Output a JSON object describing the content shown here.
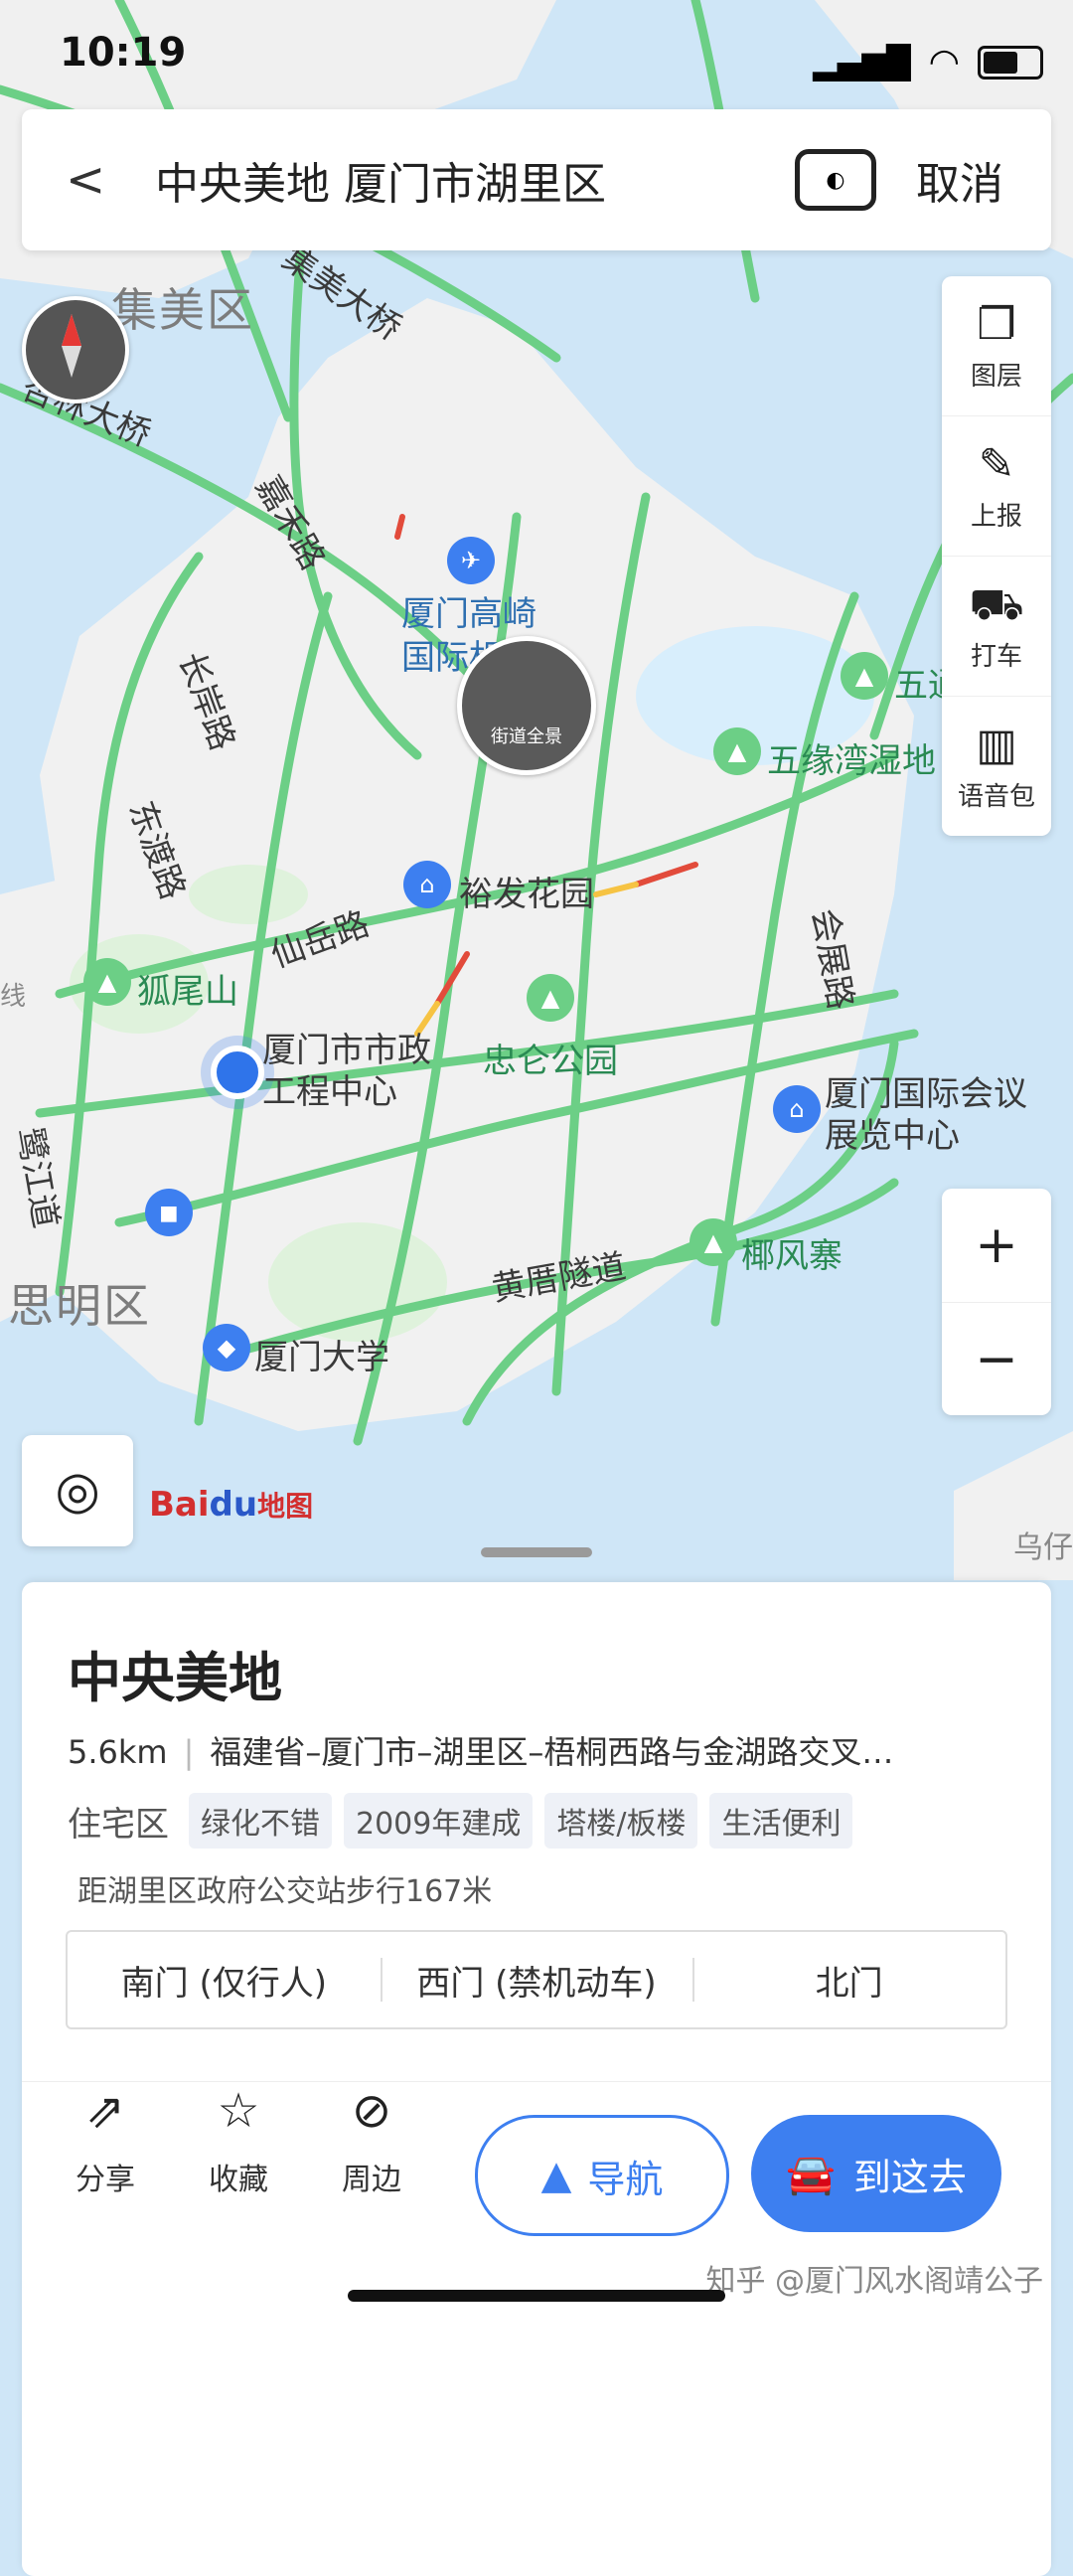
{
  "status_bar": {
    "time": "10:19"
  },
  "search": {
    "query": "中央美地 厦门市湖里区",
    "cancel_label": "取消"
  },
  "toolbar": [
    {
      "label": "图层",
      "icon": "layers-icon"
    },
    {
      "label": "上报",
      "icon": "edit-report-icon"
    },
    {
      "label": "打车",
      "icon": "taxi-icon"
    },
    {
      "label": "语音包",
      "icon": "voice-pack-icon"
    }
  ],
  "map": {
    "labels": {
      "jimei": "集美区",
      "siming": "思明区",
      "xinglin_bridge": "杏林大桥",
      "jimei_bridge": "集美大桥",
      "jiahe_road": "嘉禾路",
      "changan_road": "长岸路",
      "dongdu_road": "东渡路",
      "xianyue_road": "仙岳路",
      "lujiang_road": "鹭江道",
      "huicheng_road": "会展路",
      "huangcuo_tunnel": "黄厝隧道",
      "airport": "厦门高崎国际机场",
      "yufa": "裕发花园",
      "municipal": "厦门市市政工程中心",
      "huwei": "狐尾山",
      "zhonglun": "忠仑公园",
      "wuyuan": "五缘湾湿地",
      "wutong": "五通",
      "expo": "厦门国际会议展览中心",
      "yefeng": "椰风寨",
      "xmu": "厦门大学",
      "street_view": "街道全景",
      "line_badge": "线",
      "wuyu": "乌仔"
    }
  },
  "map_logo": {
    "bai": "Bai",
    "du": "du",
    "suffix": "地图"
  },
  "place": {
    "name": "中央美地",
    "distance": "5.6km",
    "address": "福建省–厦门市–湖里区–梧桐西路与金湖路交叉…",
    "category": "住宅区",
    "tags": [
      "绿化不错",
      "2009年建成",
      "塔楼/板楼",
      "生活便利"
    ],
    "walk_info": "距湖里区政府公交站步行167米",
    "gates": [
      "南门 (仅行人)",
      "西门 (禁机动车)",
      "北门"
    ]
  },
  "actions": [
    {
      "label": "分享",
      "icon": "share-icon"
    },
    {
      "label": "收藏",
      "icon": "star-icon"
    },
    {
      "label": "周边",
      "icon": "compass-icon"
    }
  ],
  "nav_label": "导航",
  "go_label": "到这去",
  "watermark": "知乎 @厦门风水阁靖公子",
  "colors": {
    "accent": "#3d7ff0",
    "road": "#6ccf86",
    "water": "#cfe6f7"
  }
}
